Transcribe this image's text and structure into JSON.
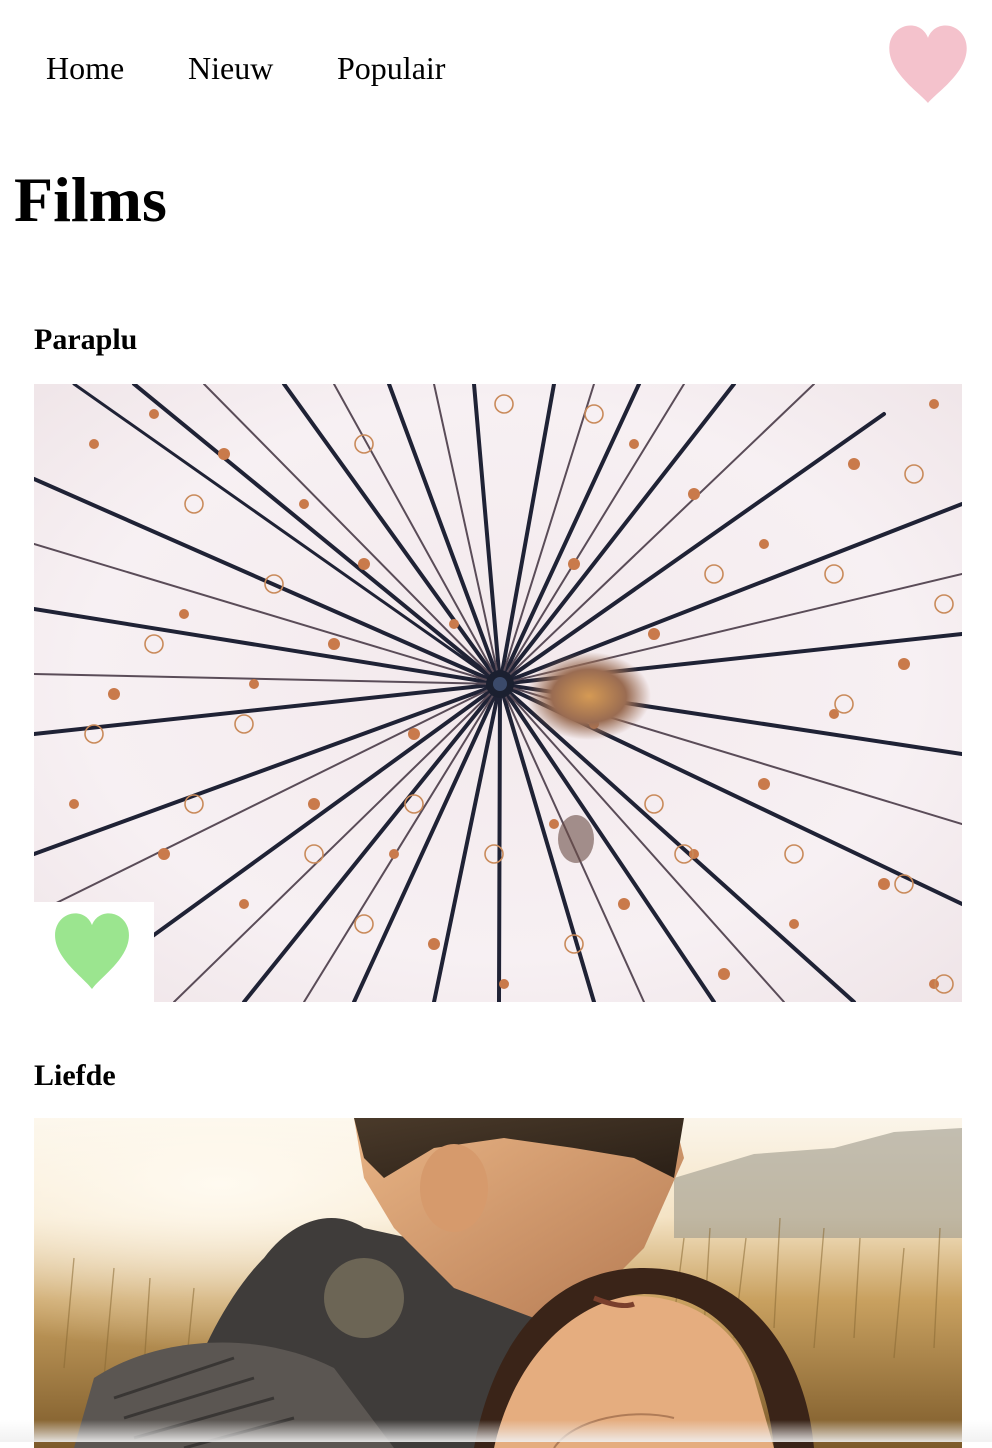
{
  "nav": {
    "items": [
      {
        "label": "Home"
      },
      {
        "label": "Nieuw"
      },
      {
        "label": "Populair"
      }
    ],
    "favorites_icon": "heart-icon",
    "favorites_color": "#f4c2cc"
  },
  "page": {
    "title": "Films"
  },
  "films": [
    {
      "title": "Paraplu",
      "image": "paper-umbrella-photo",
      "favorite_icon": "heart-icon",
      "favorite_color": "#9be58f"
    },
    {
      "title": "Liefde",
      "image": "couple-kissing-photo"
    }
  ]
}
